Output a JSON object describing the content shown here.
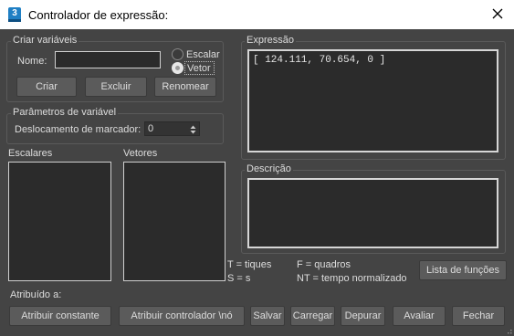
{
  "window": {
    "title": "Controlador de expressão:",
    "icon_text": "3"
  },
  "criar": {
    "group_label": "Criar variáveis",
    "name_label": "Nome:",
    "name_value": "",
    "radio_scalar": "Escalar",
    "radio_vector": "Vetor",
    "selected_type": "Vetor",
    "create_button": "Criar",
    "delete_button": "Excluir",
    "rename_button": "Renomear"
  },
  "params": {
    "group_label": "Parâmetros de variável",
    "offset_label": "Deslocamento de marcador:",
    "offset_value": "0"
  },
  "lists": {
    "scalars_label": "Escalares",
    "vectors_label": "Vetores"
  },
  "expression": {
    "label": "Expressão",
    "value": "[ 124.111, 70.654, 0 ]"
  },
  "description": {
    "label": "Descrição",
    "value": ""
  },
  "legend": {
    "ticks": "T = tiques",
    "seconds": "S = s",
    "frames": "F = quadros",
    "normalized": "NT = tempo normalizado"
  },
  "functions_button": "Lista de funções",
  "assigned_label": "Atribuído a:",
  "footer": {
    "assign_constant": "Atribuir constante",
    "assign_controller": "Atribuir controlador \\nó",
    "save": "Salvar",
    "load": "Carregar",
    "debug": "Depurar",
    "evaluate": "Avaliar",
    "close": "Fechar"
  },
  "colors": {
    "background": "#444444",
    "titlebar": "#ffffff",
    "field": "#2b2b2b",
    "button": "#5b5b5b"
  }
}
